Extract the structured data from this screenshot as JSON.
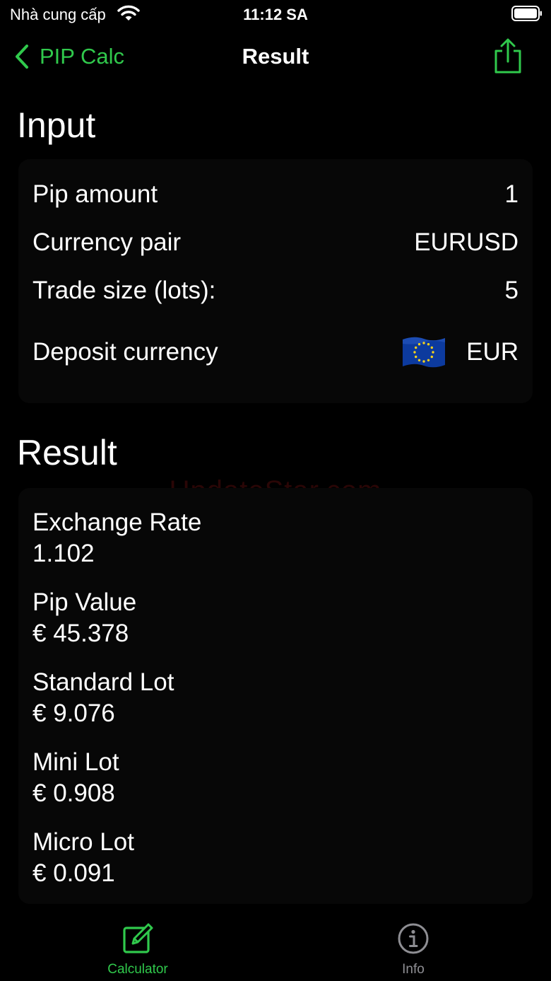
{
  "status_bar": {
    "carrier": "Nhà cung cấp",
    "time": "11:12 SA"
  },
  "nav": {
    "back_label": "PIP Calc",
    "title": "Result",
    "accent_color": "#30c94c"
  },
  "input_section": {
    "title": "Input",
    "rows": [
      {
        "label": "Pip amount",
        "value": "1"
      },
      {
        "label": "Currency pair",
        "value": "EURUSD"
      },
      {
        "label": "Trade size (lots):",
        "value": "5"
      },
      {
        "label": "Deposit currency",
        "value": "EUR",
        "icon": "eu-flag-icon"
      }
    ]
  },
  "result_section": {
    "title": "Result",
    "items": [
      {
        "label": "Exchange Rate",
        "value": "1.102"
      },
      {
        "label": "Pip Value",
        "value": "€ 45.378"
      },
      {
        "label": "Standard Lot",
        "value": "€ 9.076"
      },
      {
        "label": "Mini Lot",
        "value": "€ 0.908"
      },
      {
        "label": "Micro Lot",
        "value": "€ 0.091"
      }
    ]
  },
  "watermark": "UpdateStar.com",
  "tab_bar": {
    "tabs": [
      {
        "label": "Calculator",
        "icon": "edit-square-icon",
        "selected": true
      },
      {
        "label": "Info",
        "icon": "info-circle-icon",
        "selected": false
      }
    ]
  }
}
